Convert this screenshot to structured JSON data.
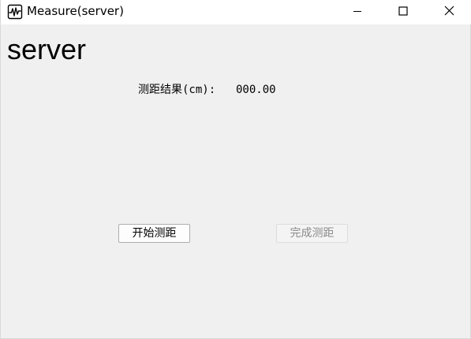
{
  "window": {
    "title": "Measure(server)",
    "icon": "waveform-icon",
    "controls": {
      "minimize": "minimize-icon",
      "maximize": "maximize-icon",
      "close": "close-icon"
    }
  },
  "main": {
    "heading": "server",
    "result_label": "测距结果(cm):",
    "result_value": "000.00",
    "start_button": {
      "label": "开始测距",
      "enabled": true
    },
    "finish_button": {
      "label": "完成测距",
      "enabled": false
    }
  }
}
